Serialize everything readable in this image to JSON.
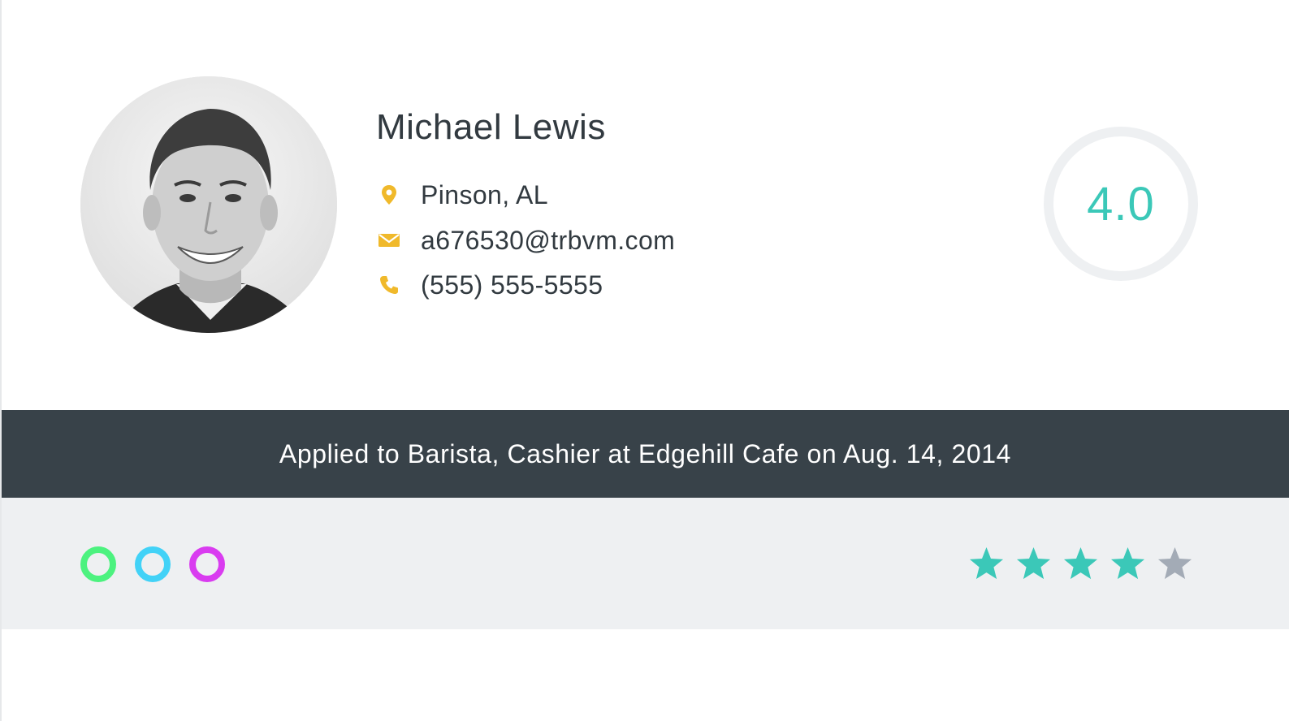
{
  "candidate": {
    "name": "Michael Lewis",
    "location": "Pinson, AL",
    "email": "a676530@trbvm.com",
    "phone": "(555) 555-5555",
    "score": "4.0",
    "rating": 4,
    "rating_max": 5
  },
  "application": {
    "text": "Applied to Barista, Cashier at Edgehill Cafe on Aug. 14, 2014"
  },
  "tags": [
    {
      "color": "#4cf27f"
    },
    {
      "color": "#42d2f7"
    },
    {
      "color": "#d93cf0"
    }
  ],
  "colors": {
    "accent": "#3bc8b8",
    "icon": "#f0b92b",
    "dark_bar": "#384249",
    "star_off": "#a3abb6"
  },
  "icons": {
    "location": "map-pin-icon",
    "email": "envelope-icon",
    "phone": "phone-icon"
  }
}
